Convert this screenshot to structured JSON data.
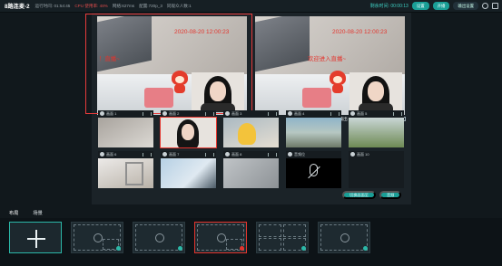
{
  "topbar": {
    "title": "8路连麦-2",
    "stats": [
      {
        "text": "运行时间: 01:54:45",
        "warn": false
      },
      {
        "text": "CPU 使用率: 48%",
        "warn": true
      },
      {
        "text": "网络:627ms",
        "warn": false
      },
      {
        "text": "配置:720p_3",
        "warn": false
      },
      {
        "text": "同观众人数:1",
        "warn": false
      }
    ],
    "remaining_time": "剩余时间: 00:00:13",
    "buttons": [
      "设置",
      "开播",
      "输出设置"
    ]
  },
  "preview": {
    "pvw_label": "PVW 预览",
    "pgm_label": "PGM 输出",
    "timestamp": "2020-08-20 12:00:23",
    "pvw_overlay": "！直播~",
    "pgm_overlay": "欢迎进入直播~"
  },
  "sources": [
    {
      "num": "1",
      "name": "画面 1"
    },
    {
      "num": "2",
      "name": "画面 2"
    },
    {
      "num": "3",
      "name": "画面 3"
    },
    {
      "num": "4",
      "name": "画面 4"
    },
    {
      "num": "5",
      "name": "画面 5"
    },
    {
      "num": "6",
      "name": "画面 6"
    },
    {
      "num": "7",
      "name": "画面 7"
    },
    {
      "num": "8",
      "name": "画面 8"
    },
    {
      "num": "9",
      "name": "音频位"
    },
    {
      "num": "10",
      "name": "画面 10"
    }
  ],
  "grid_actions": [
    "切换画面至",
    "音频"
  ],
  "bottom": {
    "tabs": [
      "布局",
      "场景"
    ],
    "add_layout_label": "+"
  }
}
